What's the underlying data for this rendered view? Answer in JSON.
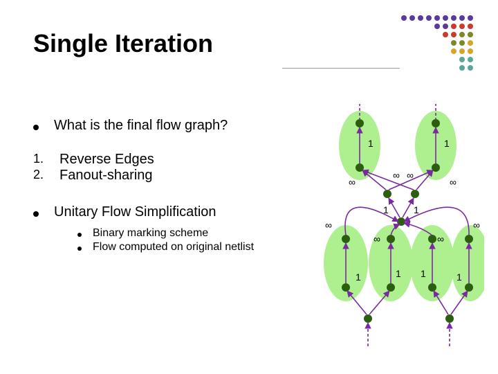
{
  "title": "Single Iteration",
  "bullets": {
    "q": "What is the final flow graph?",
    "step1_num": "1.",
    "step1": "Reverse Edges",
    "step2_num": "2.",
    "step2": "Fanout-sharing",
    "ufs": "Unitary Flow Simplification",
    "sub1": "Binary marking scheme",
    "sub2": "Flow computed on original netlist"
  },
  "diagram": {
    "edge_labels": {
      "top_left": "1",
      "top_right": "1",
      "mid_row_a": "∞",
      "mid_row_b": "∞",
      "mid_row_c": "∞",
      "mid_row_d": "∞",
      "mid_ones_l": "1",
      "mid_ones_r": "1",
      "low_inf_a": "∞",
      "low_inf_b": "∞",
      "low_inf_c": "∞",
      "low_inf_d": "∞",
      "bot_ones_a": "1",
      "bot_ones_b": "1",
      "bot_ones_c": "1",
      "bot_ones_d": "1"
    },
    "colors": {
      "node": "#2b5f0f",
      "blob": "#aef08f",
      "edge": "#7a2aa0"
    }
  },
  "deco_colors": {
    "purple": "#5b3a9b",
    "red": "#c83c2e",
    "olive": "#7a8a2a",
    "gold": "#d4a52a",
    "teal": "#5aa79a"
  }
}
